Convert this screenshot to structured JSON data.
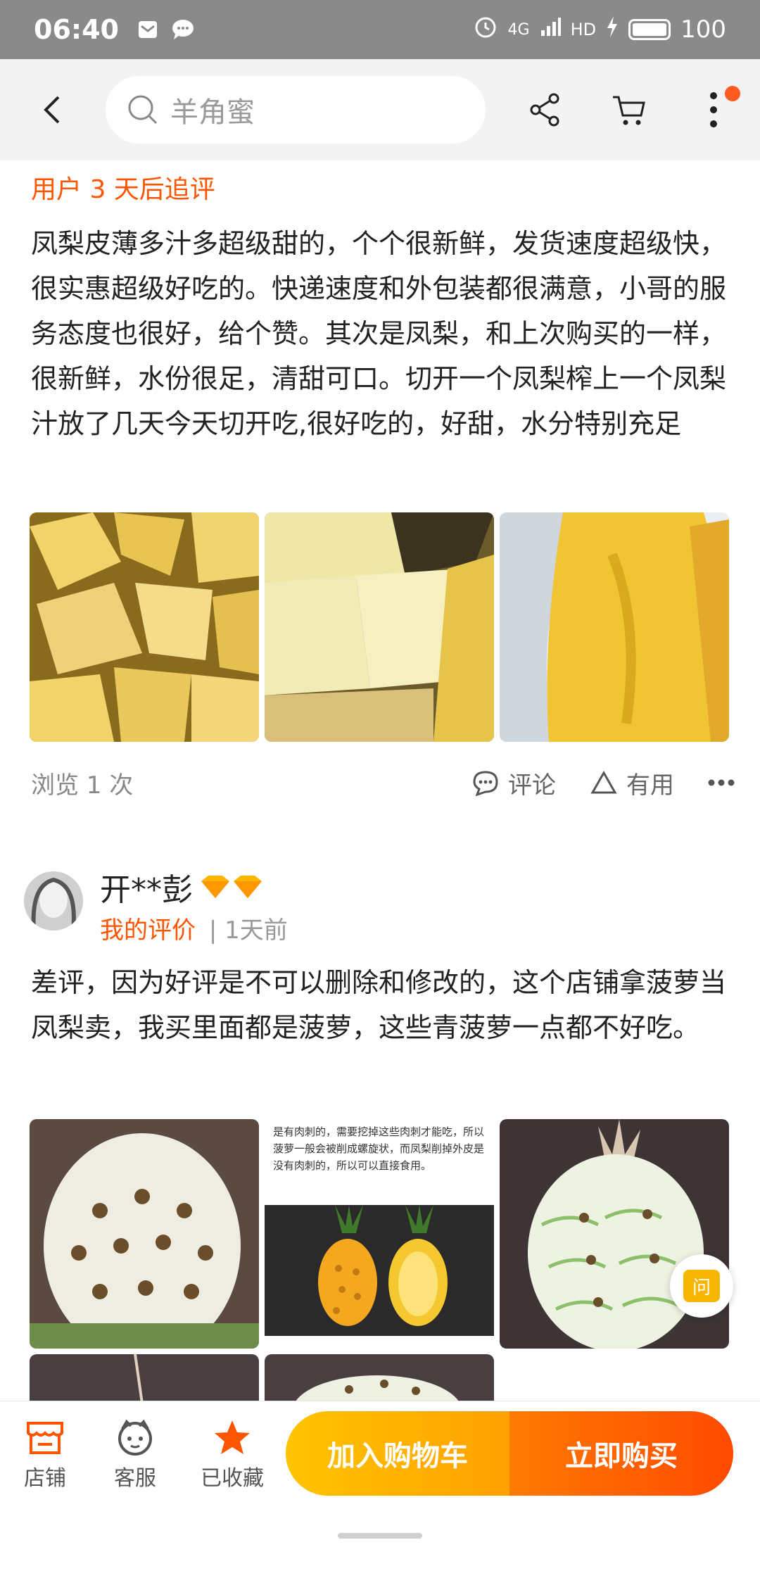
{
  "status": {
    "time": "06:40",
    "network": "4G",
    "hd": "HD",
    "battery": "100"
  },
  "topnav": {
    "search_placeholder": "羊角蜜"
  },
  "review1": {
    "followup": "用户 3 天后追评",
    "text": "凤梨皮薄多汁多超级甜的，个个很新鲜，发货速度超级快，很实惠超级好吃的。快递速度和外包装都很满意，小哥的服务态度也很好，给个赞。其次是凤梨，和上次购买的一样，很新鲜，水份很足，清甜可口。切开一个凤梨榨上一个凤梨汁放了几天今天切开吃,很好吃的，好甜，水分特别充足",
    "views": "浏览 1 次",
    "comment": "评论",
    "useful": "有用"
  },
  "review2": {
    "username": "开**彭",
    "my_review": "我的评价",
    "separator": "|",
    "time": "1天前",
    "text": "差评，因为好评是不可以删除和修改的，这个店铺拿菠萝当凤梨卖，我买里面都是菠萝，这些青菠萝一点都不好吃。",
    "image_caption": "是有肉刺的，需要挖掉这些肉刺才能吃，所以菠萝一般会被削成螺旋状，而凤梨削掉外皮是没有肉刺的，所以可以直接食用。"
  },
  "ask_bubble": "问",
  "bottombar": {
    "store": "店铺",
    "service": "客服",
    "favorited": "已收藏",
    "add_to_cart": "加入购物车",
    "buy_now": "立即购买"
  },
  "colors": {
    "accent": "#ff5500",
    "cta_yellow": "#ffa000",
    "cta_orange": "#ff4a00"
  }
}
